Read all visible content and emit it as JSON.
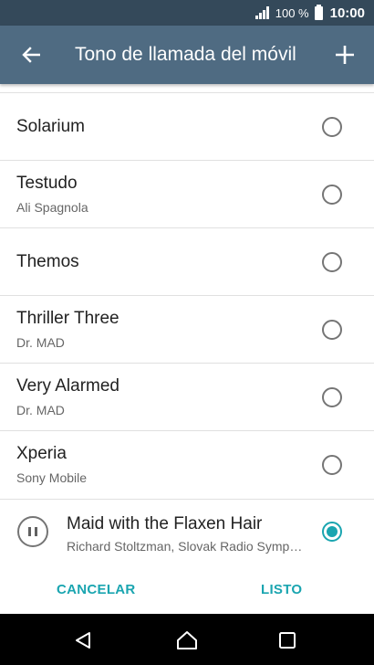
{
  "status_bar": {
    "battery": "100 %",
    "time": "10:00"
  },
  "app_bar": {
    "title": "Tono de llamada del móvil"
  },
  "ringtones": [
    {
      "title": "Solarium",
      "subtitle": ""
    },
    {
      "title": "Testudo",
      "subtitle": "Ali Spagnola"
    },
    {
      "title": "Themos",
      "subtitle": ""
    },
    {
      "title": "Thriller Three",
      "subtitle": "Dr. MAD"
    },
    {
      "title": "Very Alarmed",
      "subtitle": "Dr. MAD"
    },
    {
      "title": "Xperia",
      "subtitle": "Sony Mobile"
    }
  ],
  "selected": {
    "title": "Maid with the Flaxen Hair",
    "subtitle": "Richard Stoltzman, Slovak Radio Symphony Orchestra",
    "state": "playing",
    "icon": "pause-icon"
  },
  "dialog_actions": {
    "cancel": "CANCELAR",
    "done": "LISTO"
  },
  "colors": {
    "accent": "#1aa5b0",
    "app_bar": "#4f6b82",
    "status_bar": "#34495a"
  }
}
